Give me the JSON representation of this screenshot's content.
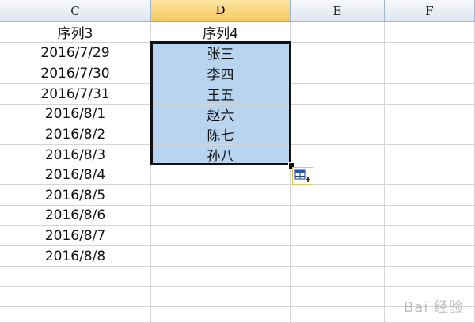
{
  "columns": [
    "C",
    "D",
    "E",
    "F"
  ],
  "col_c": [
    "序列3",
    "2016/7/29",
    "2016/7/30",
    "2016/7/31",
    "2016/8/1",
    "2016/8/2",
    "2016/8/3",
    "2016/8/4",
    "2016/8/5",
    "2016/8/6",
    "2016/8/7",
    "2016/8/8"
  ],
  "col_d": [
    "序列4",
    "张三",
    "李四",
    "王五",
    "赵六",
    "陈七",
    "孙八"
  ],
  "watermark": "Bai 经验",
  "colors": {
    "selection": "#b9d4ef",
    "active_header": "#f6c860",
    "grid": "#d4d4d4"
  },
  "icons": {
    "paste_options": "paste-options-icon"
  }
}
